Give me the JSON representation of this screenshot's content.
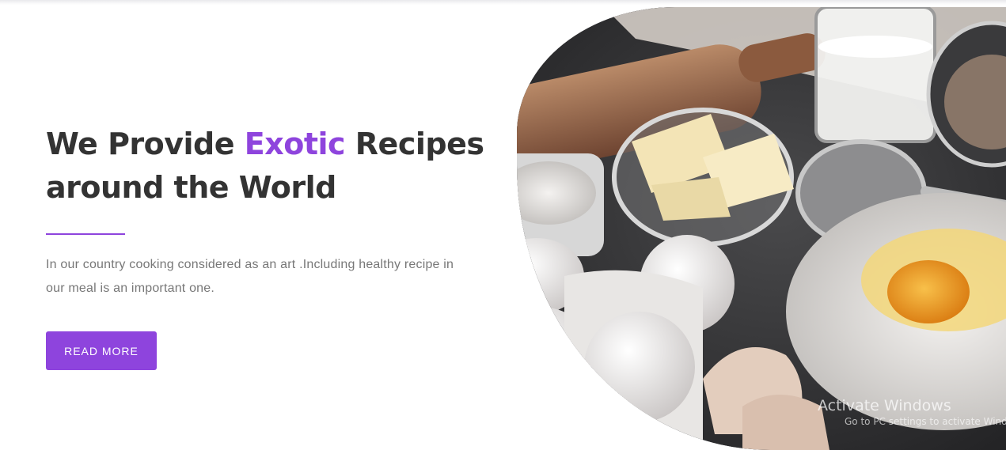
{
  "hero": {
    "headline_part1": "We Provide ",
    "headline_accent": "Exotic",
    "headline_part2": " Recipes around the World",
    "description": "In our country cooking considered as an art .Including healthy recipe in our meal is an important one.",
    "cta_label": "READ MORE",
    "image_subject": "baking ingredients: rolling pin, butter in glass bowl, milk glass, sieve, flour with egg yolk, eggs in ramekins, cracked eggshells"
  },
  "colors": {
    "accent": "#8e44dd",
    "heading": "#333333",
    "body_text": "#777777",
    "button_text": "#ffffff"
  },
  "watermark": {
    "title": "Activate Windows",
    "subtitle": "Go to PC settings to activate Windows."
  }
}
